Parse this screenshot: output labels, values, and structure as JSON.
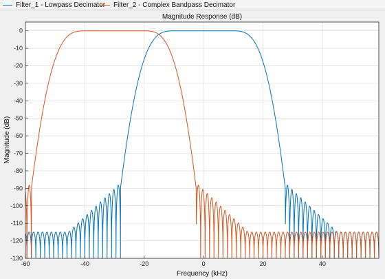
{
  "legend": {
    "entries": [
      {
        "label": "Filter_1 - Lowpass Decimator",
        "color": "#0072bd"
      },
      {
        "label": "Filter_2 - Complex Bandpass Decimator",
        "color": "#d95319"
      }
    ]
  },
  "chart_data": {
    "type": "line",
    "title": "Magnitude Response (dB)",
    "xlabel": "Frequency (kHz)",
    "ylabel": "Magnitude (dB)",
    "xlim": [
      -60,
      59
    ],
    "ylim": [
      -130,
      5
    ],
    "xticks": [
      -60,
      -40,
      -20,
      0,
      20,
      40
    ],
    "yticks": [
      0,
      -10,
      -20,
      -30,
      -40,
      -50,
      -60,
      -70,
      -80,
      -90,
      -100,
      -110,
      -120,
      -130
    ],
    "grid": true,
    "legend_position": "top",
    "series": [
      {
        "name": "Filter_1 - Lowpass Decimator",
        "color": "#0072bd",
        "passband": [
          -15,
          15
        ],
        "transition_edges": [
          -28,
          27.5
        ],
        "passband_level": 0,
        "stopband_peak_near_edge": -87,
        "stopband_peak_far": -115,
        "stopband_trough": -130,
        "lobe_spacing": 1.5
      },
      {
        "name": "Filter_2 - Complex Bandpass Decimator",
        "color": "#d95319",
        "passband": [
          -45,
          -15
        ],
        "transition_edges": [
          -58,
          -2.5
        ],
        "passband_level": 0,
        "stopband_peak_near_edge": -87,
        "stopband_peak_far": -115,
        "stopband_trough": -130,
        "lobe_spacing": 1.5
      }
    ]
  }
}
